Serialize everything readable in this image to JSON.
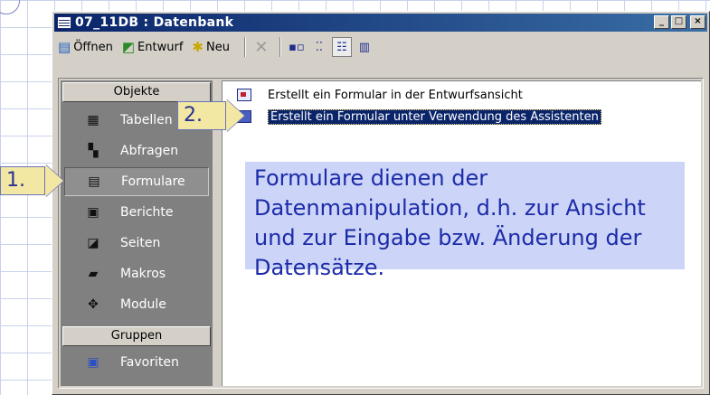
{
  "window": {
    "title": "07_11DB : Datenbank",
    "controls": {
      "minimize": "_",
      "maximize": "□",
      "close": "×"
    }
  },
  "toolbar": {
    "open_label": "Öffnen",
    "design_label": "Entwurf",
    "new_label": "Neu"
  },
  "objects": {
    "header": "Objekte",
    "items": [
      {
        "label": "Tabellen",
        "icon": "table-icon",
        "glyph": "▦"
      },
      {
        "label": "Abfragen",
        "icon": "query-icon",
        "glyph": "▚"
      },
      {
        "label": "Formulare",
        "icon": "form-icon",
        "glyph": "▤",
        "selected": true
      },
      {
        "label": "Berichte",
        "icon": "report-icon",
        "glyph": "▣"
      },
      {
        "label": "Seiten",
        "icon": "page-icon",
        "glyph": "◪"
      },
      {
        "label": "Makros",
        "icon": "macro-icon",
        "glyph": "▰"
      },
      {
        "label": "Module",
        "icon": "module-icon",
        "glyph": "✥"
      }
    ],
    "groups_header": "Gruppen",
    "favorites_label": "Favoriten"
  },
  "list": {
    "items": [
      {
        "label": "Erstellt ein Formular in der Entwurfsansicht",
        "icon": "design-form-icon",
        "selected": false
      },
      {
        "label": "Erstellt ein Formular unter Verwendung des Assistenten",
        "icon": "wizard-form-icon",
        "selected": true
      }
    ]
  },
  "callout": {
    "text": "Formulare dienen der Datenmanipulation, d.h. zur Ansicht und zur Eingabe bzw. Änderung der Datensätze."
  },
  "steps": {
    "step1": "1.",
    "step2": "2."
  },
  "colors": {
    "titlebar_start": "#0a246a",
    "titlebar_end": "#3a6ea5",
    "window_bg": "#d4d0c8",
    "objbar_bg": "#808080",
    "callout_bg": "#ccd5f8",
    "callout_text": "#1c2ba8",
    "step_bg": "#f3e7a4"
  }
}
